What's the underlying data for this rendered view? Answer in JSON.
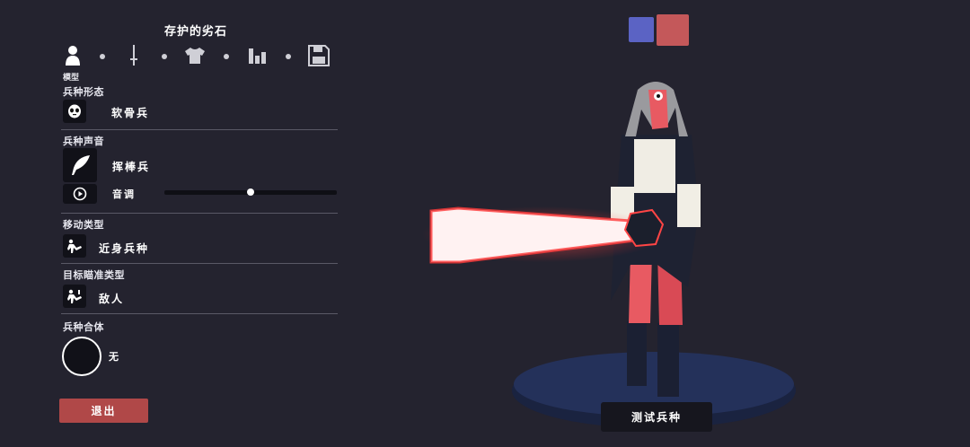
{
  "panel": {
    "title": "存护的劣石",
    "tabs": [
      {
        "name": "model",
        "icon": "person-icon",
        "caption": "模型"
      },
      {
        "name": "weapon",
        "icon": "sword-icon"
      },
      {
        "name": "clothing",
        "icon": "shirt-icon"
      },
      {
        "name": "stats",
        "icon": "bar-chart-icon"
      },
      {
        "name": "save",
        "icon": "floppy-disk-icon"
      }
    ]
  },
  "sections": {
    "body_type": {
      "label": "兵种形态",
      "value": "软骨兵",
      "icon": "mask-face-icon"
    },
    "unit_voice": {
      "label": "兵种声音",
      "value": "挥棒兵",
      "icon": "feather-icon",
      "pitch_label": "音调",
      "pitch_level": 0.5,
      "play_icon": "play-icon"
    },
    "movement": {
      "label": "移动类型",
      "value": "近身兵种",
      "icon": "melee-unit-icon"
    },
    "targeting": {
      "label": "目标瞄准类型",
      "value": "敌人",
      "icon": "target-unit-icon"
    },
    "combination": {
      "label": "兵种合体",
      "value": "无"
    }
  },
  "buttons": {
    "exit": "退出",
    "test_unit": "测试兵种"
  },
  "team_colors": {
    "blue": "#5b63c4",
    "red": "#c4585a",
    "selected": "red"
  }
}
